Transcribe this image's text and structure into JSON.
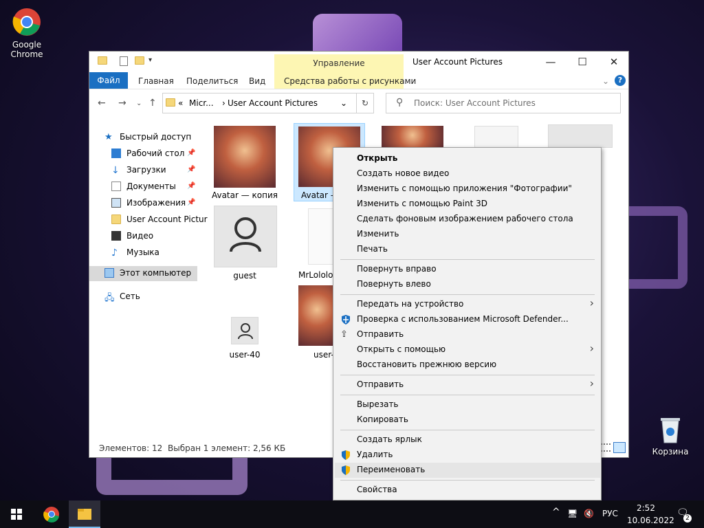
{
  "desktop": {
    "chrome_label_1": "Google",
    "chrome_label_2": "Chrome",
    "recycle_label": "Корзина"
  },
  "window": {
    "title": "User Account Pictures",
    "manage_tab": "Управление",
    "ribbon_tabs": [
      "Файл",
      "Главная",
      "Поделиться",
      "Вид",
      "Средства работы с рисунками"
    ],
    "help": "?"
  },
  "address": {
    "prefix": "«",
    "part1": "Micr...",
    "part2": "User Account Pictures",
    "search_placeholder": "Поиск: User Account Pictures"
  },
  "nav": {
    "items": [
      "Быстрый доступ",
      "Рабочий стол",
      "Загрузки",
      "Документы",
      "Изображения",
      "User Account Pictur",
      "Видео",
      "Музыка",
      "Этот компьютер",
      "Сеть"
    ]
  },
  "files": {
    "labels": [
      "Avatar — копия",
      "Avatar —",
      "guest",
      "MrLololos",
      "user-40",
      "user-"
    ]
  },
  "status": {
    "count": "Элементов: 12",
    "selected": "Выбран 1 элемент: 2,56 КБ"
  },
  "context_menu": {
    "items": [
      "Открыть",
      "Создать новое видео",
      "Изменить с помощью приложения \"Фотографии\"",
      "Изменить с помощью Paint 3D",
      "Сделать фоновым изображением рабочего стола",
      "Изменить",
      "Печать",
      "Повернуть вправо",
      "Повернуть влево",
      "Передать на устройство",
      "Проверка с использованием Microsoft Defender...",
      "Отправить",
      "Открыть с помощью",
      "Восстановить прежнюю версию",
      "Отправить",
      "Вырезать",
      "Копировать",
      "Создать ярлык",
      "Удалить",
      "Переименовать",
      "Свойства"
    ]
  },
  "taskbar": {
    "lang": "РУС",
    "time": "2:52",
    "date": "10.06.2022",
    "notifications": "2"
  },
  "colors": {
    "accent": "#1a6fc2",
    "manage": "#fdf6b3",
    "taskbar": "#0d0d14"
  }
}
